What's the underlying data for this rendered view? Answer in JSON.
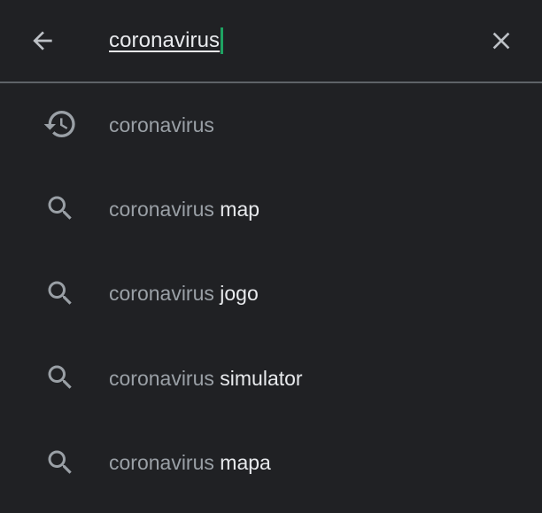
{
  "search": {
    "query": "coronavirus",
    "back_icon": "arrow-back-icon",
    "clear_icon": "close-icon"
  },
  "colors": {
    "background": "#202124",
    "primary_text": "#e8eaed",
    "secondary_text": "#9aa0a6",
    "icon": "#9aa0a6",
    "caret": "#1ea362",
    "divider": "#5f6368"
  },
  "suggestions": [
    {
      "icon": "history-icon",
      "prefix": "coronavirus",
      "suffix": ""
    },
    {
      "icon": "search-icon",
      "prefix": "coronavirus",
      "suffix": " map"
    },
    {
      "icon": "search-icon",
      "prefix": "coronavirus",
      "suffix": " jogo"
    },
    {
      "icon": "search-icon",
      "prefix": "coronavirus",
      "suffix": " simulator"
    },
    {
      "icon": "search-icon",
      "prefix": "coronavirus",
      "suffix": " mapa"
    }
  ]
}
